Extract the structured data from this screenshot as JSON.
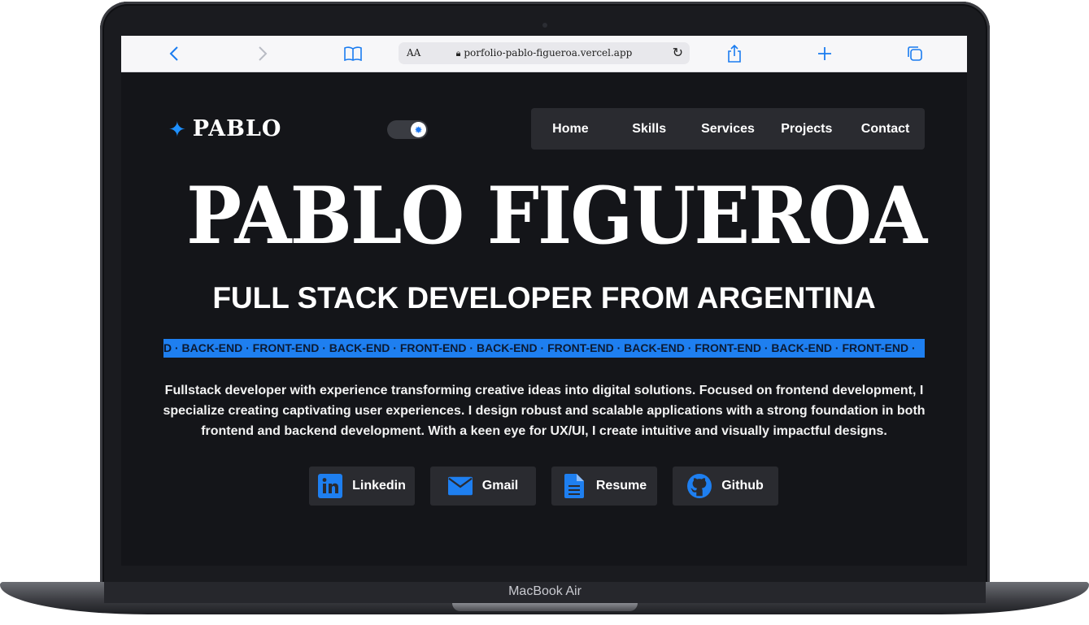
{
  "device": {
    "model_label": "MacBook Air"
  },
  "browser": {
    "aa_label": "AA",
    "url": "porfolio-pablo-figueroa.vercel.app"
  },
  "site": {
    "logo_text": "PABLO",
    "nav": [
      "Home",
      "Skills",
      "Services",
      "Projects",
      "Contact"
    ],
    "hero_name": "PABLO FIGUEROA",
    "subtitle": "FULL STACK DEVELOPER FROM ARGENTINA",
    "marquee": "D · BACK-END · FRONT-END · BACK-END · FRONT-END · BACK-END · FRONT-END · BACK-END · FRONT-END · BACK-END · FRONT-END ·",
    "description": "Fullstack developer with experience transforming creative ideas into digital solutions. Focused on frontend development, I specialize creating captivating user experiences. I design robust and scalable applications with a strong foundation in both frontend and backend development. With a keen eye for UX/UI, I create intuitive and visually impactful designs.",
    "links": [
      {
        "label": "Linkedin",
        "icon": "linkedin-icon"
      },
      {
        "label": "Gmail",
        "icon": "mail-icon"
      },
      {
        "label": "Resume",
        "icon": "document-icon"
      },
      {
        "label": "Github",
        "icon": "github-icon"
      }
    ]
  },
  "colors": {
    "accent": "#1e7ff0",
    "background": "#141519",
    "panel": "#2a2b30"
  }
}
